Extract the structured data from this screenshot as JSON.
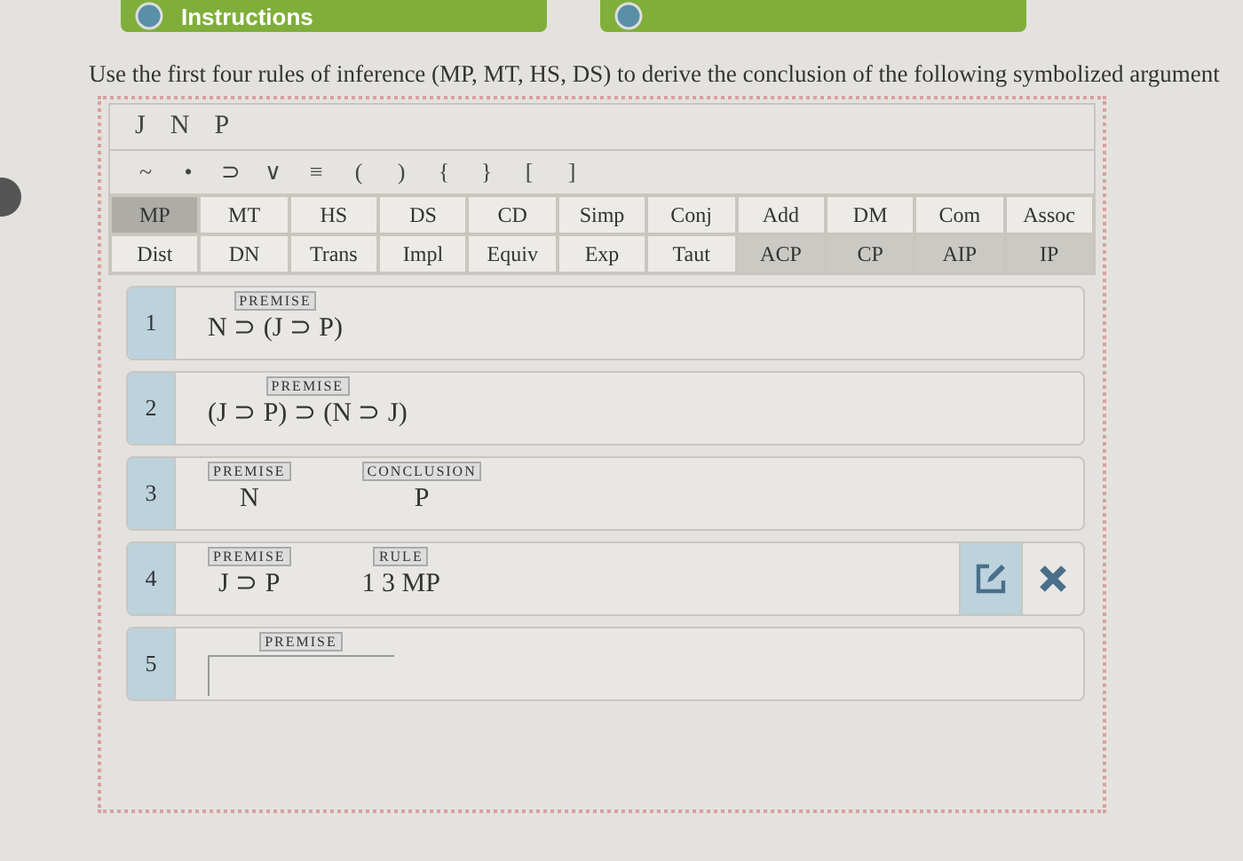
{
  "tabs": [
    {
      "kind": "tab",
      "label": "Instructions"
    },
    {
      "kind": "tab"
    }
  ],
  "instruction": "Use the first four rules of inference (MP, MT, HS, DS) to derive the conclusion of the following symbolized argument",
  "variables": [
    "J",
    "N",
    "P"
  ],
  "symbols": [
    "~",
    "•",
    "⊃",
    "∨",
    "≡",
    "(",
    ")",
    "{",
    "}",
    "[",
    "]"
  ],
  "rules": [
    {
      "label": "MP",
      "kind": "rule",
      "highlighted": true
    },
    {
      "label": "MT",
      "kind": "rule",
      "highlighted": false
    },
    {
      "label": "HS",
      "kind": "rule",
      "highlighted": false
    },
    {
      "label": "DS",
      "kind": "rule",
      "highlighted": false
    },
    {
      "label": "CD",
      "kind": "rule",
      "highlighted": false
    },
    {
      "label": "Simp",
      "kind": "rule",
      "highlighted": false
    },
    {
      "label": "Conj",
      "kind": "rule",
      "highlighted": false
    },
    {
      "label": "Add",
      "kind": "rule",
      "highlighted": false
    },
    {
      "label": "DM",
      "kind": "rule",
      "highlighted": false
    },
    {
      "label": "Com",
      "kind": "rule",
      "highlighted": false
    },
    {
      "label": "Assoc",
      "kind": "rule",
      "highlighted": false
    },
    {
      "label": "Dist",
      "kind": "rule",
      "highlighted": false
    },
    {
      "label": "DN",
      "kind": "rule",
      "highlighted": false
    },
    {
      "label": "Trans",
      "kind": "rule",
      "highlighted": false
    },
    {
      "label": "Impl",
      "kind": "rule",
      "highlighted": false
    },
    {
      "label": "Equiv",
      "kind": "rule",
      "highlighted": false
    },
    {
      "label": "Exp",
      "kind": "rule",
      "highlighted": false
    },
    {
      "label": "Taut",
      "kind": "rule",
      "highlighted": false
    },
    {
      "label": "ACP",
      "kind": "assumption",
      "highlighted": false
    },
    {
      "label": "CP",
      "kind": "assumption",
      "highlighted": false
    },
    {
      "label": "AIP",
      "kind": "assumption",
      "highlighted": false
    },
    {
      "label": "IP",
      "kind": "assumption",
      "highlighted": false
    }
  ],
  "lines": [
    {
      "number": "1",
      "cells": [
        {
          "tag": "PREMISE",
          "text": "N ⊃ (J ⊃ P)"
        }
      ],
      "editable": false
    },
    {
      "number": "2",
      "cells": [
        {
          "tag": "PREMISE",
          "text": "(J ⊃ P) ⊃ (N ⊃ J)"
        }
      ],
      "editable": false
    },
    {
      "number": "3",
      "cells": [
        {
          "tag": "PREMISE",
          "text": "N"
        },
        {
          "tag": "CONCLUSION",
          "text": "P"
        }
      ],
      "editable": false
    },
    {
      "number": "4",
      "cells": [
        {
          "tag": "PREMISE",
          "text": "J ⊃ P"
        },
        {
          "tag": "RULE",
          "text": "1 3 MP"
        }
      ],
      "editable": true
    },
    {
      "number": "5",
      "cells": [
        {
          "tag": "PREMISE",
          "input": true
        }
      ],
      "editable": false
    }
  ]
}
